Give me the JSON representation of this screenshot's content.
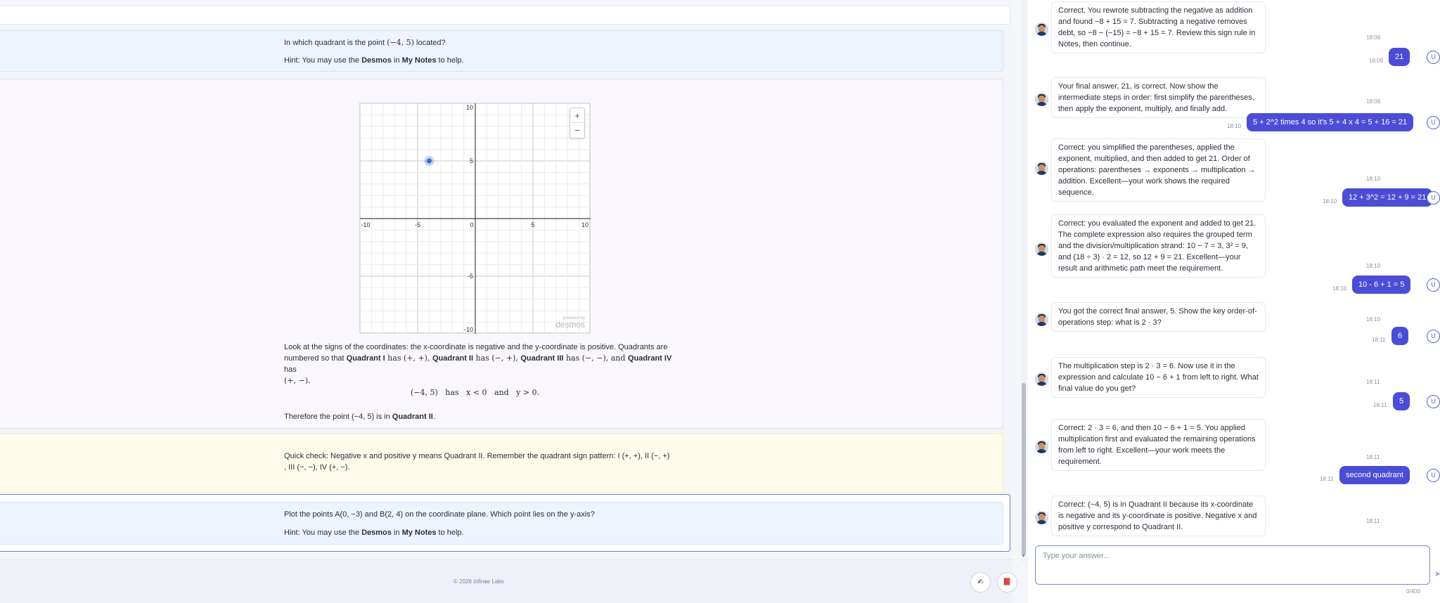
{
  "question1": {
    "text_pre": "In which quadrant is the point ",
    "point": "(−4, 5)",
    "text_post": " located?",
    "hint_pre": "Hint: You may use the ",
    "hint_desmos": "Desmos",
    "hint_mid": " in ",
    "hint_notes": "My Notes",
    "hint_post": " to help."
  },
  "graph": {
    "x_ticks": [
      "-10",
      "-5",
      "0",
      "5",
      "10"
    ],
    "y_ticks": [
      "10",
      "5",
      "-5",
      "-10"
    ],
    "zoom_in": "+",
    "zoom_out": "−",
    "watermark_small": "powered by",
    "watermark": "desmos",
    "point_x": -4,
    "point_y": 5,
    "point_color": "#2f6fd6"
  },
  "solution": {
    "line1_a": "Look at the signs of the coordinates: the x-coordinate is negative and the y-coordinate is positive. Quadrants are",
    "line2_a": "numbered so that ",
    "q1": "Quadrant I",
    "q1_sign": " has (+, +), ",
    "q2": "Quadrant II",
    "q2_sign": " has (−, +), ",
    "q3": "Quadrant III",
    "q3_sign": " has (−, −), and ",
    "q4": "Quadrant IV",
    "q4_sign": " has",
    "line3": "(+, −).",
    "display": "(−4, 5)   has   x < 0   and   y > 0.",
    "conclusion_pre": "Therefore the point (−4, 5) is in ",
    "conclusion_q": "Quadrant II",
    "conclusion_post": "."
  },
  "quick_check": {
    "line1": "Quick check: Negative x and positive y means Quadrant II. Remember the quadrant sign pattern: I (+, +), II (−, +)",
    "line2": ", III (−, −), IV (+, −)."
  },
  "question2": {
    "text": "Plot the points A(0, −3) and B(2, 4) on the coordinate plane. Which point lies on the y-axis?",
    "hint_pre": "Hint: You may use the ",
    "hint_desmos": "Desmos",
    "hint_mid": " in ",
    "hint_notes": "My Notes",
    "hint_post": " to help."
  },
  "footer": {
    "copyright": "© 2026 Infinae Labs",
    "btn1_icon": "✍",
    "btn2_icon": "📕"
  },
  "chat": {
    "messages": [
      {
        "text": "Correct. You rewrote subtracting the negative as addition and found −8 + 15 = 7. Subtracting a negative removes debt, so −8 − (−15) = −8 + 15 = 7. Review this sign rule in Notes, then continue.",
        "time": "18:09"
      },
      {
        "user": "21",
        "time": "18:09"
      },
      {
        "text": "Your final answer, 21, is correct. Now show the intermediate steps in order: first simplify the parentheses, then apply the exponent, multiply, and finally add.",
        "time": "18:09"
      },
      {
        "user": "5 + 2^2 times 4 so it's 5 + 4 x 4 = 5 + 16 = 21",
        "time": "18:10"
      },
      {
        "text": "Correct: you simplified the parentheses, applied the exponent, multiplied, and then added to get 21. Order of operations: parentheses → exponents → multiplication → addition. Excellent—your work shows the required sequence.",
        "time": "18:10"
      },
      {
        "user": "12 + 3^2 = 12 + 9 = 21",
        "time": "18:10"
      },
      {
        "text": "Correct: you evaluated the exponent and added to get 21. The complete expression also requires the grouped term and the division/multiplication strand: 10 − 7 = 3, 3² = 9, and (18 ÷ 3) · 2 = 12, so 12 + 9 = 21. Excellent—your result and arithmetic path meet the requirement.",
        "time": "18:10"
      },
      {
        "user": "10 - 6 + 1 = 5",
        "time": "18:10"
      },
      {
        "text": "You got the correct final answer, 5. Show the key order-of-operations step: what is 2 · 3?",
        "time": "18:10"
      },
      {
        "user": "6",
        "time": "18:11"
      },
      {
        "text": "The multiplication step is 2 · 3 = 6. Now use it in the expression and calculate 10 − 6 + 1 from left to right. What final value do you get?",
        "time": "18:11"
      },
      {
        "user": "5",
        "time": "18:11"
      },
      {
        "text": "Correct: 2 · 3 = 6, and then 10 − 6 + 1 = 5. You applied multiplication first and evaluated the remaining operations from left to right. Excellent—your work meets the requirement.",
        "time": "18:11"
      },
      {
        "user": "second quadrant",
        "time": "18:11"
      },
      {
        "text": "Correct: (−4, 5) is in Quadrant II because its x-coordinate is negative and its y-coordinate is positive. Negative x and positive y correspond to Quadrant II.",
        "time": "18:11"
      }
    ],
    "user_avatar": "U",
    "input_placeholder": "Type your answer...",
    "counter": "0/400",
    "send_icon": "➤"
  }
}
